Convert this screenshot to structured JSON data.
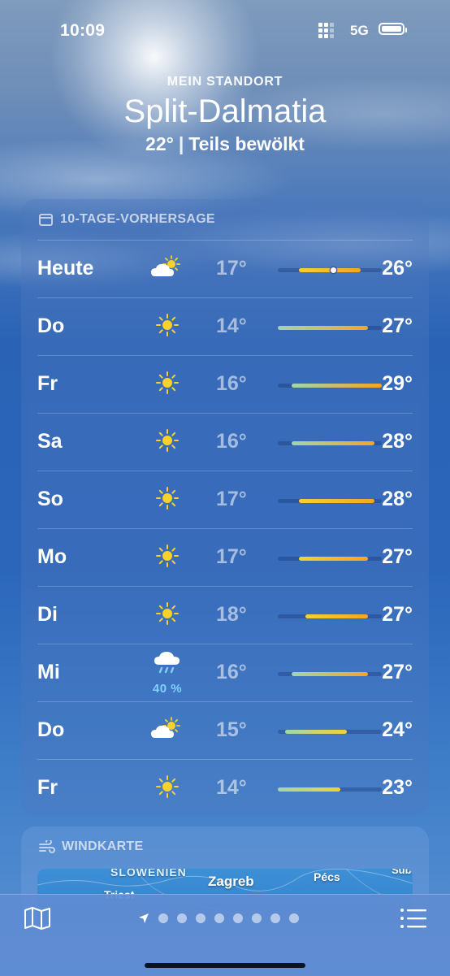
{
  "status_bar": {
    "time": "10:09",
    "network": "5G"
  },
  "header": {
    "location_label": "MEIN STANDORT",
    "city": "Split-Dalmatia",
    "current_temp": "22°",
    "condition": "Teils bewölkt"
  },
  "forecast": {
    "title": "10-TAGE-VORHERSAGE",
    "icon": "calendar-icon",
    "scale_min": 14,
    "scale_max": 29,
    "current_temp_value": 22,
    "days": [
      {
        "day": "Heute",
        "icon": "partly-cloudy-icon",
        "low": "17°",
        "high": "26°",
        "low_v": 17,
        "high_v": 26,
        "precip": ""
      },
      {
        "day": "Do",
        "icon": "sun-icon",
        "low": "14°",
        "high": "27°",
        "low_v": 14,
        "high_v": 27,
        "precip": ""
      },
      {
        "day": "Fr",
        "icon": "sun-icon",
        "low": "16°",
        "high": "29°",
        "low_v": 16,
        "high_v": 29,
        "precip": ""
      },
      {
        "day": "Sa",
        "icon": "sun-icon",
        "low": "16°",
        "high": "28°",
        "low_v": 16,
        "high_v": 28,
        "precip": ""
      },
      {
        "day": "So",
        "icon": "sun-icon",
        "low": "17°",
        "high": "28°",
        "low_v": 17,
        "high_v": 28,
        "precip": ""
      },
      {
        "day": "Mo",
        "icon": "sun-icon",
        "low": "17°",
        "high": "27°",
        "low_v": 17,
        "high_v": 27,
        "precip": ""
      },
      {
        "day": "Di",
        "icon": "sun-icon",
        "low": "18°",
        "high": "27°",
        "low_v": 18,
        "high_v": 27,
        "precip": ""
      },
      {
        "day": "Mi",
        "icon": "rain-cloud-icon",
        "low": "16°",
        "high": "27°",
        "low_v": 16,
        "high_v": 27,
        "precip": "40 %"
      },
      {
        "day": "Do",
        "icon": "partly-cloudy-icon",
        "low": "15°",
        "high": "24°",
        "low_v": 15,
        "high_v": 24,
        "precip": ""
      },
      {
        "day": "Fr",
        "icon": "sun-icon",
        "low": "14°",
        "high": "23°",
        "low_v": 14,
        "high_v": 23,
        "precip": ""
      }
    ]
  },
  "wind_map": {
    "title": "WINDKARTE",
    "icon": "wind-icon",
    "labels": {
      "country": "SLOWENIEN",
      "zagreb": "Zagreb",
      "pecs": "Pécs",
      "trst": "Triest",
      "edge": "Sub"
    }
  },
  "bottom_bar": {
    "pages": 8,
    "map_icon": "map-icon",
    "list_icon": "list-icon"
  },
  "colors": {
    "bar_cool": "#9fd6b0",
    "bar_mid": "#f2d233",
    "bar_warm": "#f5a524"
  }
}
